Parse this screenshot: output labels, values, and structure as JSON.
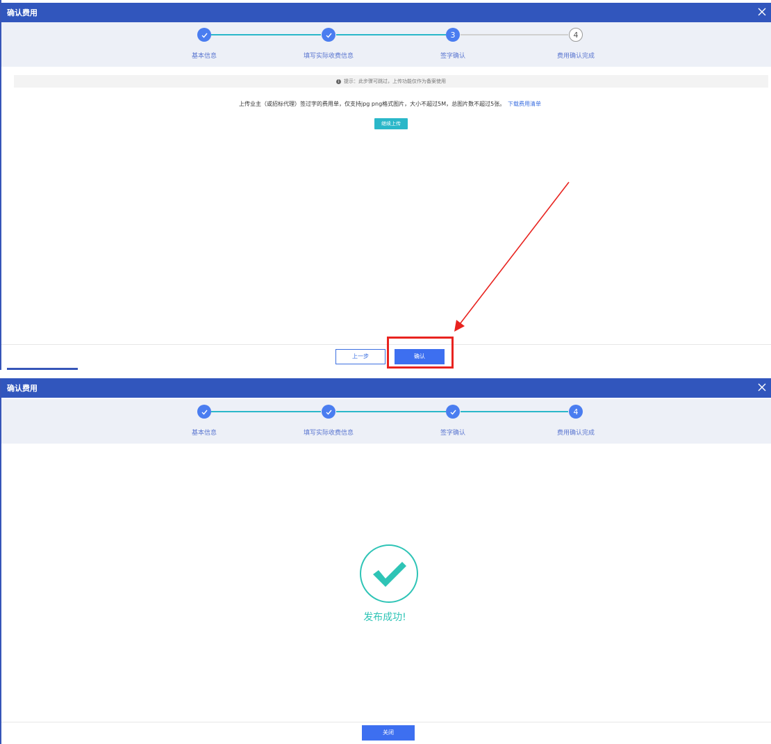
{
  "dialog": {
    "title": "确认费用"
  },
  "steps": [
    {
      "num": "1",
      "label": "基本信息"
    },
    {
      "num": "2",
      "label": "填写实际收费信息"
    },
    {
      "num": "3",
      "label": "签字确认"
    },
    {
      "num": "4",
      "label": "费用确认完成"
    }
  ],
  "upload_step": {
    "hint": "提示：此步骤可跳过，上传功能仅作为备案使用",
    "instruction": "上传业主（或招标代理）签过字的费用单，仅支持jpg png格式图片，大小不超过5M，总图片数不超过5张。",
    "download_link": "下载费用清单",
    "continue_upload": "继续上传",
    "prev_label": "上一步",
    "confirm_label": "确认"
  },
  "complete_step": {
    "success_message": "发布成功!",
    "close_label": "关闭"
  },
  "colors": {
    "title_bar": "#3156bd",
    "step_active": "#4a7df0",
    "step_line_done": "#2ab7c9",
    "highlight": "#e8231f",
    "success": "#2ec4b6"
  },
  "icons": [
    "close-icon",
    "check-icon",
    "info-icon",
    "success-check-icon",
    "annotation-arrow"
  ]
}
